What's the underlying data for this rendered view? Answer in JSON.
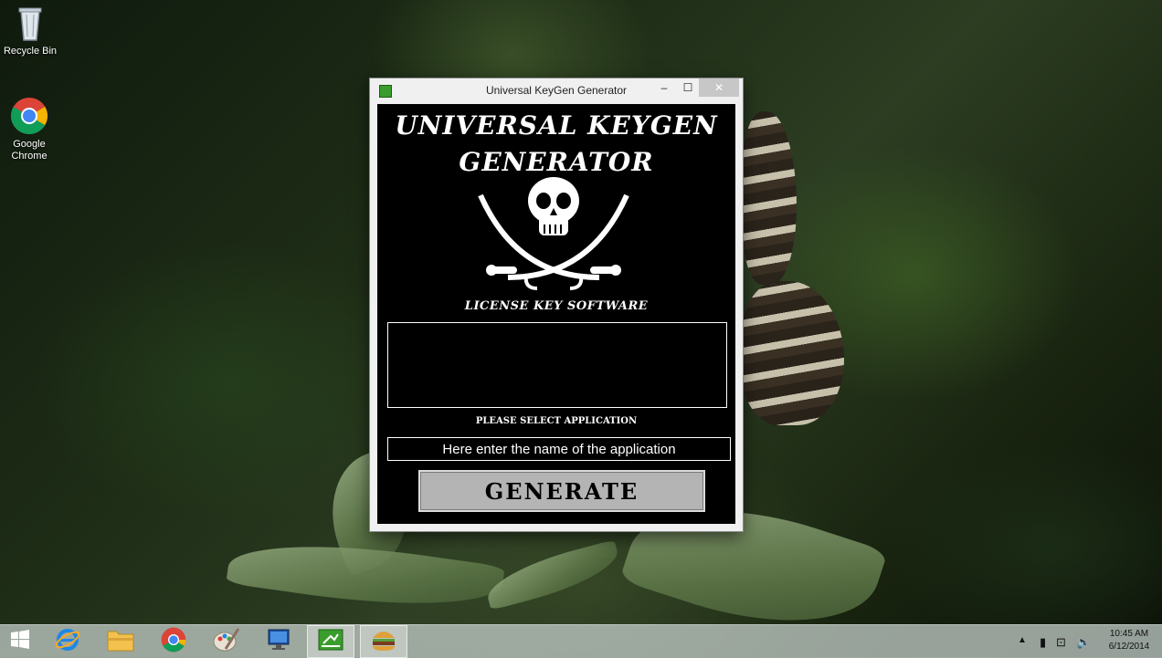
{
  "desktop": {
    "icons": [
      {
        "label": "Recycle Bin",
        "icon": "recycle-bin-icon"
      },
      {
        "label": "Google Chrome",
        "icon": "chrome-icon"
      }
    ]
  },
  "window": {
    "title": "Universal KeyGen Generator",
    "minimize_glyph": "–",
    "maximize_glyph": "☐",
    "close_glyph": "✕",
    "app_title_line1": "UNIVERSAL KEYGEN",
    "app_title_line2": "GENERATOR",
    "logo": "skull-crossed-swords-icon",
    "subtitle": "LICENSE KEY SOFTWARE",
    "output_value": "",
    "select_label": "PLEASE SELECT APPLICATION",
    "app_input_placeholder": "Here enter the name of the application",
    "generate_label": "GENERATE"
  },
  "taskbar": {
    "items": [
      {
        "name": "start-button",
        "icon": "windows-logo-icon"
      },
      {
        "name": "internet-explorer",
        "icon": "ie-icon"
      },
      {
        "name": "file-explorer",
        "icon": "folder-icon"
      },
      {
        "name": "chrome",
        "icon": "chrome-icon"
      },
      {
        "name": "paint",
        "icon": "paint-icon"
      },
      {
        "name": "remote-desktop",
        "icon": "computer-icon"
      },
      {
        "name": "keygen-app",
        "icon": "keygen-app-icon"
      },
      {
        "name": "burger-app",
        "icon": "burger-icon"
      }
    ],
    "clock_time": "10:45 AM",
    "clock_date": "6/12/2014"
  },
  "colors": {
    "window_bg": "#f0f0f0",
    "client_bg": "#000000",
    "button_bg": "#b4b4b4",
    "taskbar_bg": "#bec8c3"
  }
}
